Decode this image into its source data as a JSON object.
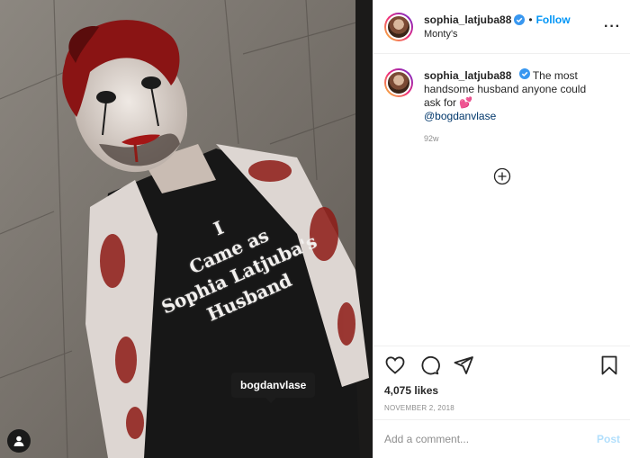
{
  "post": {
    "username": "sophia_latjuba88",
    "follow_label": "Follow",
    "dot": "•",
    "location": "Monty's",
    "more_icon": "more-dots-icon",
    "verified_icon": "verified-badge-icon"
  },
  "photo": {
    "shirt_lines": [
      "I",
      "Came as",
      "Sophia Latjuba's",
      "Husband"
    ],
    "tag_label": "bogdanvlase",
    "tag_icon": "user-tag-icon"
  },
  "caption": {
    "username": "sophia_latjuba88",
    "text": "The most handsome husband anyone could ask for",
    "emoji": "💕",
    "mention": "@bogdanvlase",
    "time": "92w",
    "load_more_icon": "plus-circle-icon"
  },
  "actions": {
    "icons": [
      "heart-icon",
      "comment-icon",
      "share-icon",
      "save-icon"
    ],
    "likes": "4,075 likes",
    "date": "NOVEMBER 2, 2018"
  },
  "comment": {
    "placeholder": "Add a comment...",
    "post_label": "Post"
  },
  "colors": {
    "link_blue": "#0095f6",
    "post_disabled": "#b2dffc",
    "muted_text": "#8e8e8e",
    "border": "#efefef"
  }
}
